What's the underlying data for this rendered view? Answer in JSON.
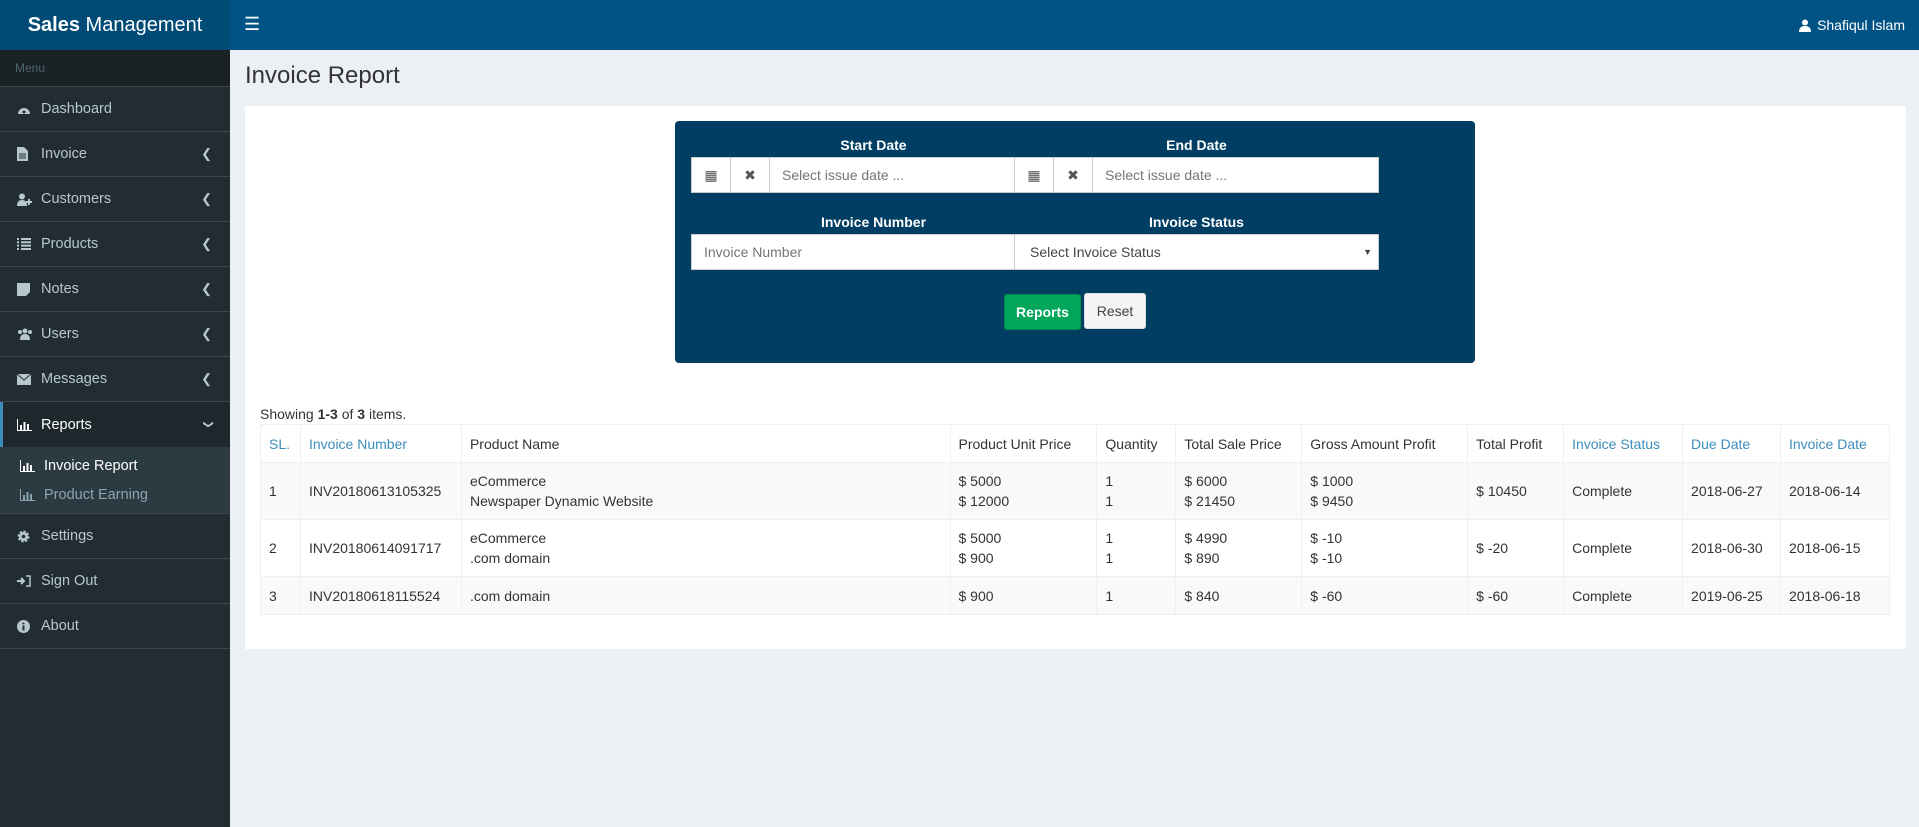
{
  "header": {
    "brand_bold": "Sales",
    "brand_rest": " Management",
    "user": "Shafiqul Islam"
  },
  "sidebar": {
    "menu_label": "Menu",
    "items": [
      {
        "label": "Dashboard",
        "icon": "dashboard-icon"
      },
      {
        "label": "Invoice",
        "icon": "file-icon"
      },
      {
        "label": "Customers",
        "icon": "user-plus-icon"
      },
      {
        "label": "Products",
        "icon": "list-icon"
      },
      {
        "label": "Notes",
        "icon": "note-icon"
      },
      {
        "label": "Users",
        "icon": "users-icon"
      },
      {
        "label": "Messages",
        "icon": "envelope-icon"
      },
      {
        "label": "Reports",
        "icon": "bar-chart-icon"
      },
      {
        "label": "Settings",
        "icon": "gear-icon"
      },
      {
        "label": "Sign Out",
        "icon": "sign-in-icon"
      },
      {
        "label": "About",
        "icon": "info-icon"
      }
    ],
    "reports_sub": [
      {
        "label": "Invoice Report"
      },
      {
        "label": "Product Earning"
      }
    ]
  },
  "page": {
    "title": "Invoice Report"
  },
  "filter": {
    "start_label": "Start Date",
    "end_label": "End Date",
    "date_placeholder": "Select issue date ...",
    "number_label": "Invoice Number",
    "number_placeholder": "Invoice Number",
    "status_label": "Invoice Status",
    "status_value": "Select Invoice Status",
    "reports_btn": "Reports",
    "reset_btn": "Reset"
  },
  "summary": {
    "prefix": "Showing ",
    "range": "1-3",
    "mid": " of ",
    "total": "3",
    "suffix": " items."
  },
  "table": {
    "headers": [
      "SL.",
      "Invoice Number",
      "Product Name",
      "Product Unit Price",
      "Quantity",
      "Total Sale Price",
      "Gross Amount Profit",
      "Total Profit",
      "Invoice Status",
      "Due Date",
      "Invoice Date"
    ],
    "rows": [
      {
        "sl": "1",
        "inv": "INV20180613105325",
        "products": [
          "eCommerce",
          "Newspaper Dynamic Website"
        ],
        "unit": [
          "$ 5000",
          "$ 12000"
        ],
        "qty": [
          "1",
          "1"
        ],
        "sale": [
          "$ 6000",
          "$ 21450"
        ],
        "gross": [
          "$ 1000",
          "$ 9450"
        ],
        "profit": "$ 10450",
        "status": "Complete",
        "due": "2018-06-27",
        "date": "2018-06-14"
      },
      {
        "sl": "2",
        "inv": "INV20180614091717",
        "products": [
          "eCommerce",
          ".com domain"
        ],
        "unit": [
          "$ 5000",
          "$ 900"
        ],
        "qty": [
          "1",
          "1"
        ],
        "sale": [
          "$ 4990",
          "$ 890"
        ],
        "gross": [
          "$ -10",
          "$ -10"
        ],
        "profit": "$ -20",
        "status": "Complete",
        "due": "2018-06-30",
        "date": "2018-06-15"
      },
      {
        "sl": "3",
        "inv": "INV20180618115524",
        "products": [
          ".com domain"
        ],
        "unit": [
          "$ 900"
        ],
        "qty": [
          "1"
        ],
        "sale": [
          "$ 840"
        ],
        "gross": [
          "$ -60"
        ],
        "profit": "$ -60",
        "status": "Complete",
        "due": "2019-06-25",
        "date": "2018-06-18"
      }
    ]
  }
}
